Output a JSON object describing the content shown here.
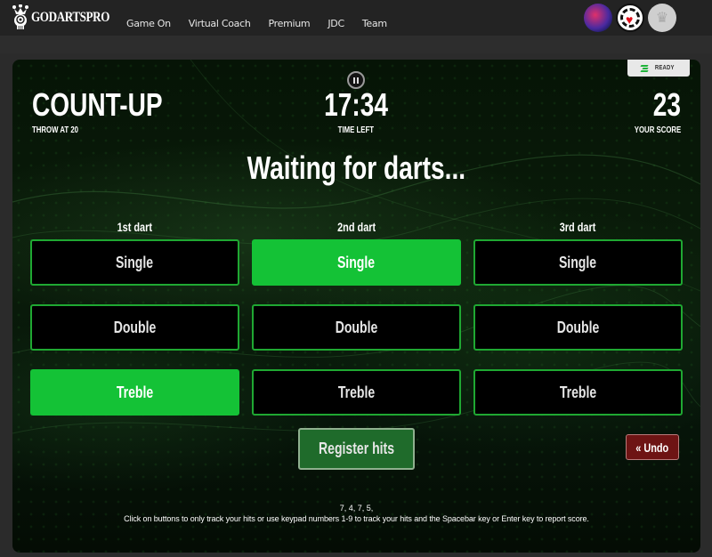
{
  "header": {
    "logo_text": "GODARTSPRO",
    "nav": [
      "Game On",
      "Virtual Coach",
      "Premium",
      "JDC",
      "Team"
    ],
    "avatars": [
      "skull-avatar",
      "heart-dartboard-avatar",
      "default-avatar"
    ]
  },
  "game": {
    "status_badge": "READY",
    "mode_title": "COUNT-UP",
    "mode_subtitle": "THROW AT 20",
    "time_value": "17:34",
    "time_label": "TIME LEFT",
    "score_value": "23",
    "score_label": "YOUR SCORE",
    "heading": "Waiting for darts...",
    "darts": [
      {
        "label": "1st dart",
        "options": [
          {
            "label": "Single",
            "selected": false
          },
          {
            "label": "Double",
            "selected": false
          },
          {
            "label": "Treble",
            "selected": true
          }
        ]
      },
      {
        "label": "2nd dart",
        "options": [
          {
            "label": "Single",
            "selected": true
          },
          {
            "label": "Double",
            "selected": false
          },
          {
            "label": "Treble",
            "selected": false
          }
        ]
      },
      {
        "label": "3rd dart",
        "options": [
          {
            "label": "Single",
            "selected": false
          },
          {
            "label": "Double",
            "selected": false
          },
          {
            "label": "Treble",
            "selected": false
          }
        ]
      }
    ],
    "register_label": "Register hits",
    "undo_label": "« Undo",
    "throw_sequence": "7, 4, 7, 5,",
    "hint": "Click on buttons to only track your hits or use keypad numbers 1-9 to track your hits and the Spacebar key or Enter key to report score."
  },
  "colors": {
    "active_green": "#14c236",
    "border_green": "#1fa832",
    "register_green": "#1f6b2b",
    "undo_red": "#6e1414"
  }
}
